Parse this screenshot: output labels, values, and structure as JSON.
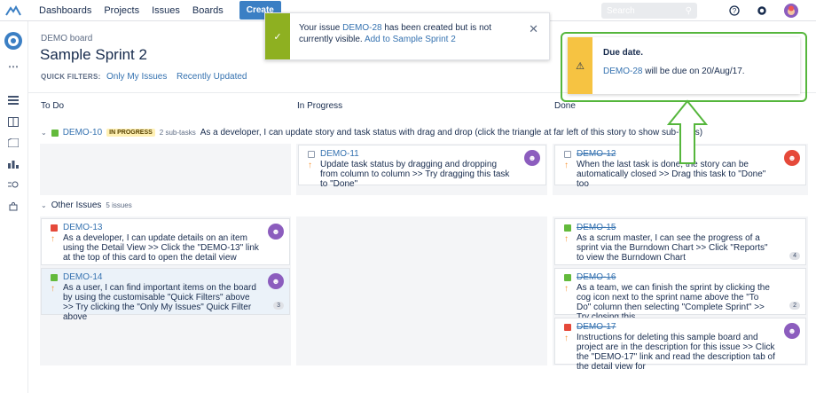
{
  "topnav": {
    "items": [
      "Dashboards",
      "Projects",
      "Issues",
      "Boards"
    ],
    "create_label": "Create",
    "search_placeholder": "Search"
  },
  "board": {
    "breadcrumb": "DEMO board",
    "title": "Sample Sprint 2",
    "quick_filters_label": "QUICK FILTERS:",
    "quick_filters": [
      "Only My Issues",
      "Recently Updated"
    ]
  },
  "columns": [
    "To Do",
    "In Progress",
    "Done"
  ],
  "swimlane_story": {
    "key": "DEMO-10",
    "status": "IN PROGRESS",
    "subtasks": "2 sub-tasks",
    "summary": "As a developer, I can update story and task status with drag and drop (click the triangle at far left of this story to show sub-tasks)"
  },
  "swimlane_other": {
    "label": "Other Issues",
    "count": "5 issues"
  },
  "cards": {
    "demo11": {
      "key": "DEMO-11",
      "summary": "Update task status by dragging and dropping from column to column >> Try dragging this task to \"Done\""
    },
    "demo12": {
      "key": "DEMO-12",
      "summary": "When the last task is done, the story can be automatically closed >> Drag this task to \"Done\" too"
    },
    "demo13": {
      "key": "DEMO-13",
      "summary": "As a developer, I can update details on an item using the Detail View >> Click the \"DEMO-13\" link at the top of this card to open the detail view"
    },
    "demo14": {
      "key": "DEMO-14",
      "summary": "As a user, I can find important items on the board by using the customisable \"Quick Filters\" above >> Try clicking the \"Only My Issues\" Quick Filter above",
      "count": "3"
    },
    "demo15": {
      "key": "DEMO-15",
      "summary": "As a scrum master, I can see the progress of a sprint via the Burndown Chart >> Click \"Reports\" to view the Burndown Chart",
      "count": "4"
    },
    "demo16": {
      "key": "DEMO-16",
      "summary": "As a team, we can finish the sprint by clicking the cog icon next to the sprint name above the \"To Do\" column then selecting \"Complete Sprint\" >> Try closing this",
      "count": "2"
    },
    "demo17": {
      "key": "DEMO-17",
      "summary": "Instructions for deleting this sample board and project are in the description for this issue >> Click the \"DEMO-17\" link and read the description tab of the detail view for"
    }
  },
  "flag": {
    "text_before": "Your issue ",
    "key": "DEMO-28",
    "text_after": " has been created but is not currently visible.",
    "link": "Add to Sample Sprint 2"
  },
  "alert": {
    "heading": "Due date.",
    "key": "DEMO-28",
    "text": " will be due on 20/Aug/17."
  },
  "colors": {
    "accent": "#3b7fc4",
    "success": "#8eb021",
    "warning": "#f6c342",
    "highlight_border": "#55b63c"
  }
}
